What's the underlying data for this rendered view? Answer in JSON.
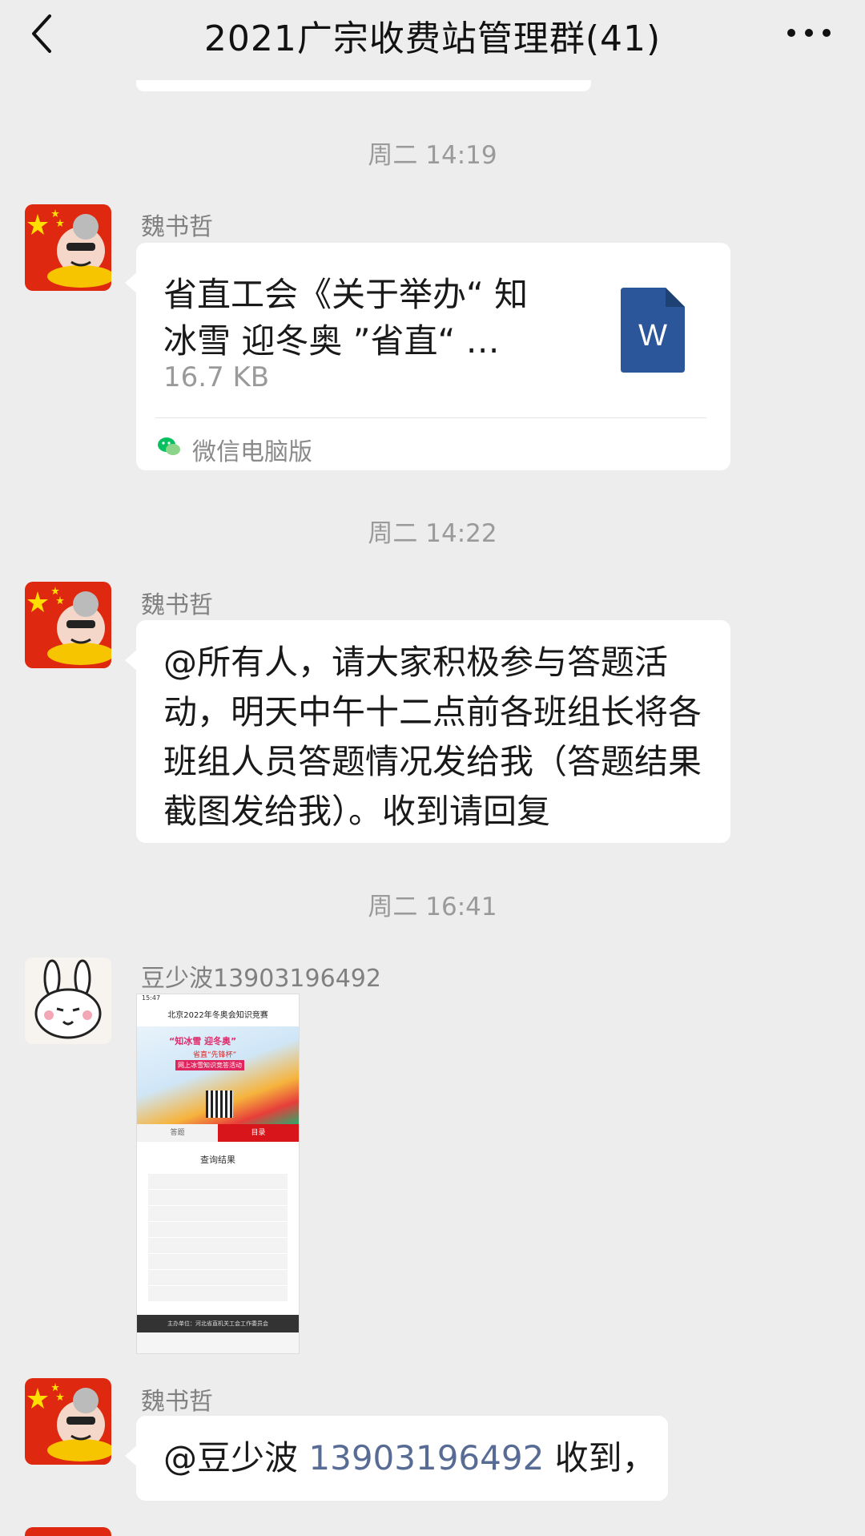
{
  "header": {
    "title": "2021广宗收费站管理群(41)",
    "back_icon": "chevron-left-icon",
    "more_icon": "more-horizontal-icon"
  },
  "messages": [
    {
      "time": "周二 14:19",
      "sender": "魏书哲",
      "type": "file",
      "file": {
        "name_line1": "省直工会《关于举办“ 知",
        "name_line2": "冰雪 迎冬奥 ”省直“ …",
        "size": "16.7 KB",
        "icon": "word-doc-icon",
        "icon_letter": "W",
        "source": "微信电脑版"
      }
    },
    {
      "time": "周二 14:22",
      "sender": "魏书哲",
      "type": "text",
      "text": "@所有人，请大家积极参与答题活动，明天中午十二点前各班组长将各班组人员答题情况发给我（答题结果截图发给我）。收到请回复"
    },
    {
      "time": "周二 16:41",
      "sender": "豆少波13903196492",
      "type": "image",
      "image": {
        "header": "北京2022年冬奥会知识竞赛",
        "banner_line1": "“知冰雪  迎冬奥”",
        "banner_line2": "省直“先锋杯”",
        "banner_line3": "网上冰雪知识竞答活动",
        "tab_left": "答题",
        "tab_right": "目录",
        "section_title": "查询结果",
        "footer": "主办单位：河北省直机关工会工作委员会"
      }
    },
    {
      "sender": "魏书哲",
      "type": "text",
      "mention": "@豆少波",
      "phone": "13903196492",
      "suffix": " 收到，"
    }
  ],
  "colors": {
    "background": "#ededed",
    "bubble": "#ffffff",
    "link": "#576b95",
    "word_blue": "#2b579a",
    "wechat_green": "#07c160"
  }
}
